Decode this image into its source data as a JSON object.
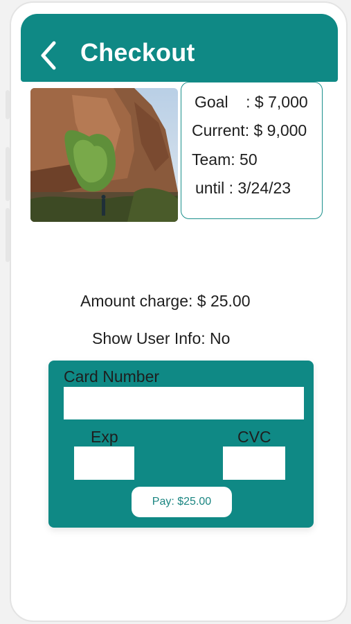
{
  "header": {
    "title": "Checkout",
    "back_icon": "chevron-left-icon"
  },
  "campaign": {
    "image_description": "desert rock cliff with green shrub and a person",
    "stats": {
      "goal": "Goal    : $ 7,000",
      "current": "Current: $ 9,000",
      "team": "Team: 50",
      "until": "until : 3/24/23"
    }
  },
  "summary": {
    "amount_charge": "Amount charge: $ 25.00",
    "show_user_info": "Show User Info: No"
  },
  "payment": {
    "card_number_label": "Card Number",
    "exp_label": "Exp",
    "cvc_label": "CVC",
    "card_number_value": "",
    "exp_value": "",
    "cvc_value": "",
    "pay_button_label": "Pay: $25.00"
  },
  "colors": {
    "brand": "#0f8985",
    "text": "#1e1e1e",
    "background": "#ffffff"
  }
}
